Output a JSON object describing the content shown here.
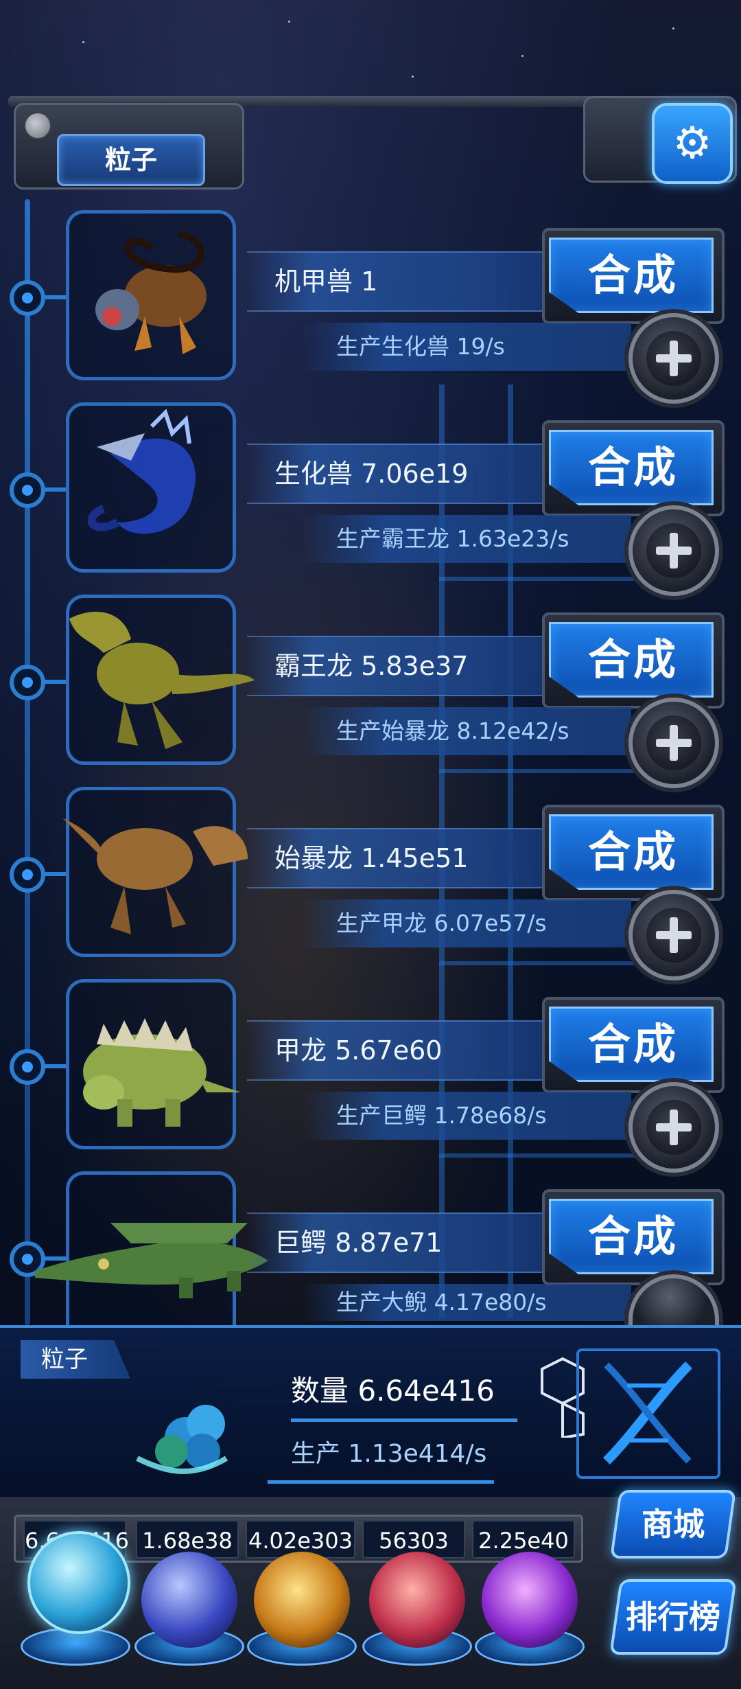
{
  "header": {
    "title": "粒子",
    "settings_icon": "gear-icon"
  },
  "creatures": [
    {
      "name": "机甲兽 1",
      "production": "生产生化兽 19/s",
      "synth_label": "合成"
    },
    {
      "name": "生化兽 7.06e19",
      "production": "生产霸王龙 1.63e23/s",
      "synth_label": "合成"
    },
    {
      "name": "霸王龙 5.83e37",
      "production": "生产始暴龙 8.12e42/s",
      "synth_label": "合成"
    },
    {
      "name": "始暴龙 1.45e51",
      "production": "生产甲龙 6.07e57/s",
      "synth_label": "合成"
    },
    {
      "name": "甲龙 5.67e60",
      "production": "生产巨鳄 1.78e68/s",
      "synth_label": "合成"
    },
    {
      "name": "巨鳄 8.87e71",
      "production": "生产大鲵 4.17e80/s",
      "synth_label": "合成"
    }
  ],
  "particle_panel": {
    "tag": "粒子",
    "count": "数量 6.64e416",
    "production": "生产 1.13e414/s"
  },
  "currencies": [
    {
      "value": "6.64e416",
      "icon": "particle-orb-icon"
    },
    {
      "value": "1.68e38",
      "icon": "lightning-orb-icon"
    },
    {
      "value": "4.02e303",
      "icon": "fire-orb-icon"
    },
    {
      "value": "56303",
      "icon": "brain-orb-icon"
    },
    {
      "value": "2.25e40",
      "icon": "vortex-orb-icon"
    }
  ],
  "side_buttons": {
    "shop": "商城",
    "rank": "排行榜"
  }
}
